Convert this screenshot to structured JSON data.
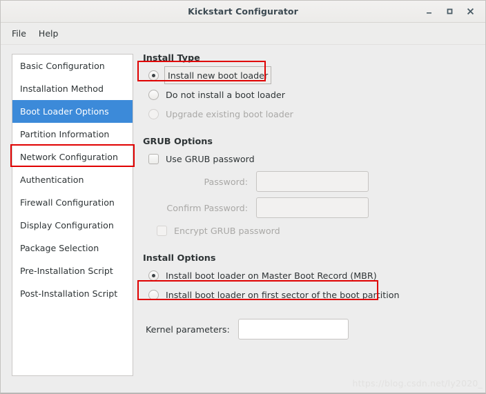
{
  "window": {
    "title": "Kickstart Configurator",
    "controls": [
      {
        "name": "minimize",
        "glyph": "–"
      },
      {
        "name": "maximize",
        "glyph": "□"
      },
      {
        "name": "close",
        "glyph": "✕"
      }
    ]
  },
  "menubar": {
    "items": [
      {
        "label": "File"
      },
      {
        "label": "Help"
      }
    ]
  },
  "sidebar": {
    "items": [
      {
        "label": "Basic Configuration",
        "selected": false
      },
      {
        "label": "Installation Method",
        "selected": false
      },
      {
        "label": "Boot Loader Options",
        "selected": true
      },
      {
        "label": "Partition Information",
        "selected": false
      },
      {
        "label": "Network Configuration",
        "selected": false
      },
      {
        "label": "Authentication",
        "selected": false
      },
      {
        "label": "Firewall Configuration",
        "selected": false
      },
      {
        "label": "Display Configuration",
        "selected": false
      },
      {
        "label": "Package Selection",
        "selected": false
      },
      {
        "label": "Pre-Installation Script",
        "selected": false
      },
      {
        "label": "Post-Installation Script",
        "selected": false
      }
    ]
  },
  "install_type": {
    "heading": "Install Type",
    "options": [
      {
        "label": "Install new boot loader",
        "checked": true,
        "disabled": false,
        "focused": true
      },
      {
        "label": "Do not install a boot loader",
        "checked": false,
        "disabled": false,
        "focused": false
      },
      {
        "label": "Upgrade existing boot loader",
        "checked": false,
        "disabled": true,
        "focused": false
      }
    ]
  },
  "grub_options": {
    "heading": "GRUB Options",
    "use_grub_password": {
      "label": "Use GRUB password",
      "checked": false,
      "disabled": false
    },
    "password": {
      "label": "Password:",
      "value": "",
      "placeholder": "",
      "disabled": true
    },
    "confirm_password": {
      "label": "Confirm Password:",
      "value": "",
      "placeholder": "",
      "disabled": true
    },
    "encrypt": {
      "label": "Encrypt GRUB password",
      "checked": false,
      "disabled": true
    }
  },
  "install_options": {
    "heading": "Install Options",
    "options": [
      {
        "label": "Install boot loader on Master Boot Record (MBR)",
        "checked": true,
        "disabled": false
      },
      {
        "label": "Install boot loader on first sector of the boot partition",
        "checked": false,
        "disabled": false
      }
    ]
  },
  "kernel_parameters": {
    "label": "Kernel parameters:",
    "value": "",
    "placeholder": ""
  },
  "watermark": {
    "text": "https://blog.csdn.net/ly2020_"
  },
  "colors": {
    "selection_blue": "#3c8ad9",
    "annotation_red": "#e00000",
    "window_bg": "#ededed",
    "text": "#2e3436",
    "disabled_text": "#a9a8a6"
  }
}
